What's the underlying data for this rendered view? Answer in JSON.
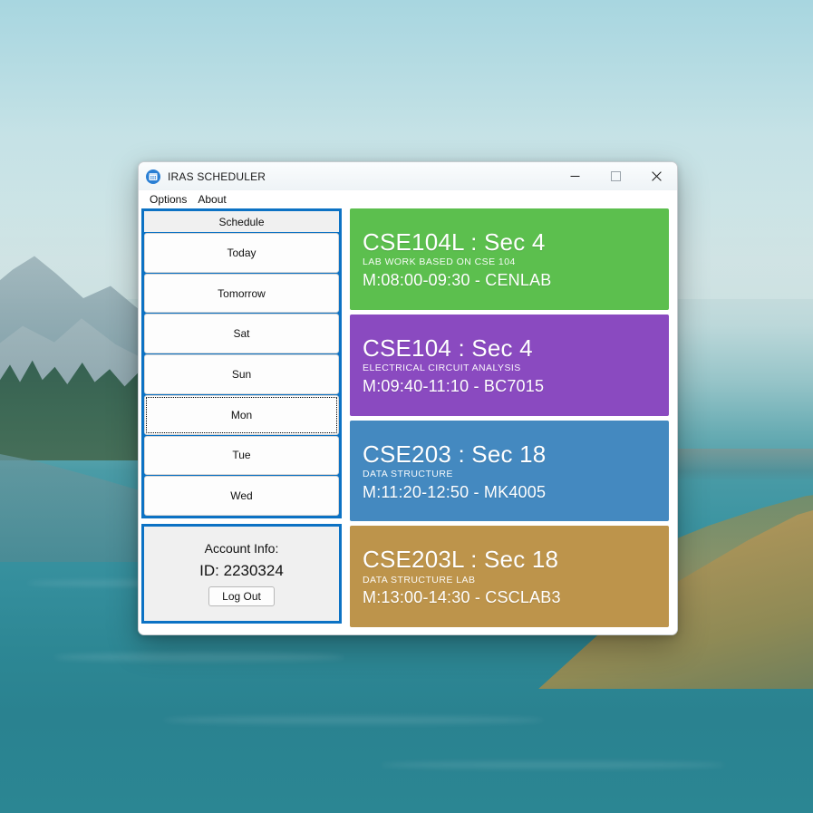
{
  "window": {
    "title": "IRAS SCHEDULER",
    "icon": "calendar-icon",
    "controls": {
      "minimize": "–",
      "maximize": "□",
      "close": "✕"
    }
  },
  "menu": {
    "items": [
      {
        "label": "Options"
      },
      {
        "label": "About"
      }
    ]
  },
  "sidebar": {
    "schedule": {
      "header": "Schedule",
      "days": [
        {
          "label": "Today",
          "focused": false
        },
        {
          "label": "Tomorrow",
          "focused": false
        },
        {
          "label": "Sat",
          "focused": false
        },
        {
          "label": "Sun",
          "focused": false
        },
        {
          "label": "Mon",
          "focused": true
        },
        {
          "label": "Tue",
          "focused": false
        },
        {
          "label": "Wed",
          "focused": false
        }
      ]
    },
    "account": {
      "title": "Account Info:",
      "id_label": "ID: 2230324",
      "logout_label": "Log Out"
    }
  },
  "courses": [
    {
      "title": "CSE104L : Sec 4",
      "description": "LAB WORK BASED ON CSE 104",
      "time": "M:08:00-09:30 - CENLAB",
      "color": "#5cbf4e"
    },
    {
      "title": "CSE104 : Sec 4",
      "description": "ELECTRICAL CIRCUIT ANALYSIS",
      "time": "M:09:40-11:10 - BC7015",
      "color": "#8a4ac0"
    },
    {
      "title": "CSE203 : Sec 18",
      "description": "DATA STRUCTURE",
      "time": "M:11:20-12:50 - MK4005",
      "color": "#4489c0"
    },
    {
      "title": "CSE203L : Sec 18",
      "description": "DATA STRUCTURE LAB",
      "time": "M:13:00-14:30 - CSCLAB3",
      "color": "#bd944b"
    }
  ],
  "theme": {
    "panel_border": "#0c72c4",
    "panel_fill": "#f0f0f0",
    "titlebar": "#eef3f6"
  }
}
